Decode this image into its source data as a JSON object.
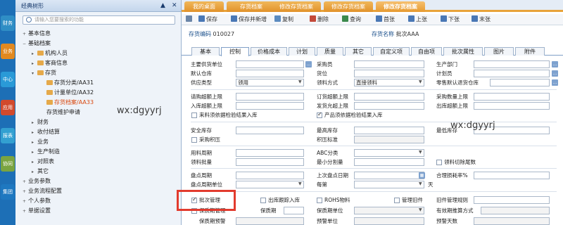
{
  "left_rail": {
    "items": [
      {
        "label": "财务",
        "color": "#2f8ec5"
      },
      {
        "label": "业务",
        "color": "#e2891f"
      },
      {
        "label": "中心",
        "color": "#2a9ad7"
      },
      {
        "label": "应用",
        "color": "#d24a2d"
      },
      {
        "label": "报表",
        "color": "#33a0d1"
      },
      {
        "label": "协同",
        "color": "#7aa441"
      },
      {
        "label": "集团",
        "color": "#1e78c0"
      }
    ]
  },
  "nav": {
    "title": "经典树形",
    "pin_icon": "▲",
    "close_icon": "✕",
    "search_placeholder": "请输入您要搜索的功能",
    "items": [
      {
        "label": "基本信息",
        "toggle": "+",
        "indent": 0
      },
      {
        "label": "基础档案",
        "toggle": "−",
        "indent": 0
      },
      {
        "label": "机构人员",
        "toggle": "▸",
        "indent": 1,
        "folder": true
      },
      {
        "label": "客商信息",
        "toggle": "▸",
        "indent": 1,
        "folder": true
      },
      {
        "label": "存货",
        "toggle": "▾",
        "indent": 1,
        "folder": true
      },
      {
        "label": "存货分类/AA31",
        "toggle": "",
        "indent": 2,
        "folder": true
      },
      {
        "label": "计量单位/AA32",
        "toggle": "",
        "indent": 2,
        "folder": true
      },
      {
        "label": "存货档案/AA33",
        "toggle": "",
        "indent": 2,
        "folder": true,
        "selected": true
      },
      {
        "label": "存货维护申请",
        "toggle": "",
        "indent": 2
      },
      {
        "label": "财务",
        "toggle": "▸",
        "indent": 1
      },
      {
        "label": "收付结算",
        "toggle": "▸",
        "indent": 1
      },
      {
        "label": "业务",
        "toggle": "▸",
        "indent": 1
      },
      {
        "label": "生产制造",
        "toggle": "▸",
        "indent": 1
      },
      {
        "label": "对照表",
        "toggle": "▸",
        "indent": 1
      },
      {
        "label": "其它",
        "toggle": "▸",
        "indent": 1
      },
      {
        "label": "业务参数",
        "toggle": "+",
        "indent": 0
      },
      {
        "label": "业务流程配置",
        "toggle": "+",
        "indent": 0
      },
      {
        "label": "个人参数",
        "toggle": "+",
        "indent": 0
      },
      {
        "label": "单据设置",
        "toggle": "+",
        "indent": 0
      }
    ]
  },
  "tabs": [
    {
      "label": "我的桌面",
      "active": false
    },
    {
      "label": "存货档案",
      "active": false
    },
    {
      "label": "修改存货档案",
      "active": false
    },
    {
      "label": "修改存货档案",
      "active": false
    },
    {
      "label": "修改存货档案",
      "active": true
    }
  ],
  "toolbar": {
    "items": [
      {
        "label": "",
        "icon": "print-icon",
        "color": "#6b86a8"
      },
      {
        "label": "保存",
        "icon": "save-icon",
        "color": "#4a78b5"
      },
      {
        "label": "保存并新增",
        "icon": "save-new-icon",
        "color": "#4a78b5"
      },
      {
        "label": "复制",
        "icon": "copy-icon",
        "color": "#5b8bc0"
      },
      {
        "label": "删除",
        "icon": "delete-icon",
        "color": "#c34a3a"
      },
      {
        "label": "查询",
        "icon": "query-icon",
        "color": "#3b8a4d"
      },
      {
        "label": "首张",
        "icon": "first-icon",
        "color": "#4a78b5"
      },
      {
        "label": "上张",
        "icon": "prev-icon",
        "color": "#4a78b5"
      },
      {
        "label": "下张",
        "icon": "next-icon",
        "color": "#4a78b5"
      },
      {
        "label": "末张",
        "icon": "last-icon",
        "color": "#4a78b5"
      }
    ]
  },
  "doc_head": {
    "code_label": "存货编码",
    "code_value": "010027",
    "name_label": "存货名称",
    "name_value": "批次AAA"
  },
  "subtabs": [
    {
      "label": "基本",
      "active": false
    },
    {
      "label": "控制",
      "active": true
    },
    {
      "label": "价格成本",
      "active": false
    },
    {
      "label": "计划",
      "active": false
    },
    {
      "label": "质量",
      "active": false
    },
    {
      "label": "其它",
      "active": false
    },
    {
      "label": "自定义项",
      "active": false
    },
    {
      "label": "自由项",
      "active": false
    },
    {
      "label": "批次属性",
      "active": false
    },
    {
      "label": "图片",
      "active": false
    },
    {
      "label": "附件",
      "active": false
    }
  ],
  "form": {
    "supplier": "主要供货单位",
    "buyer": "采购员",
    "dept": "生产部门",
    "default_wh": "默认仓库",
    "location": "货位",
    "planner": "计划员",
    "supply_type": "供应类型",
    "supply_type_value": "领用",
    "pick_method": "领料方式",
    "pick_method_value": "直接领料",
    "zero_default_wh": "零售默认退货仓库",
    "req_over_limit": "请购超额上限",
    "order_over_limit": "订货超额上限",
    "purchase_qty_limit": "采购数量上限",
    "in_over_limit": "入库超额上限",
    "ship_allow_limit": "发货允超上限",
    "out_over_limit": "出库超额上限",
    "chk_material": "来料须依据检验结果入库",
    "chk_product": "产品须依据检验结果入库",
    "safety_stock": "安全库存",
    "max_stock": "最高库存",
    "min_stock": "最低库存",
    "replenish": "采购积压",
    "backlog_std": "积压标准",
    "usage_cycle": "用料周期",
    "abc_class": "ABC分类",
    "pick_batch": "领料批量",
    "min_split": "最小分割量",
    "chk_material_cut": "领料切除尾数",
    "count_cycle": "盘点周期",
    "last_count_date": "上次盘点日期",
    "reasonable_loss": "合理损耗率%",
    "count_cycle_unit": "盘点周期单位",
    "each": "每第",
    "day": "天",
    "chk_batch": "批次管理",
    "chk_outbound": "出库跟踪入库",
    "chk_rohs": "ROHS物料",
    "chk_oldnew": "管理旧件",
    "oldnew_rule": "旧件管理规则",
    "chk_shelf": "保质期管理",
    "shelf_period": "保质期",
    "shelf_unit": "保质期单位",
    "valid_method": "有效期推算方式",
    "shelf_warn": "保质期预警",
    "warn_unit": "预警单位",
    "warn_days": "预警天数"
  },
  "watermarks": [
    "wx:dgyyrj",
    "wx:dgyyrj"
  ]
}
